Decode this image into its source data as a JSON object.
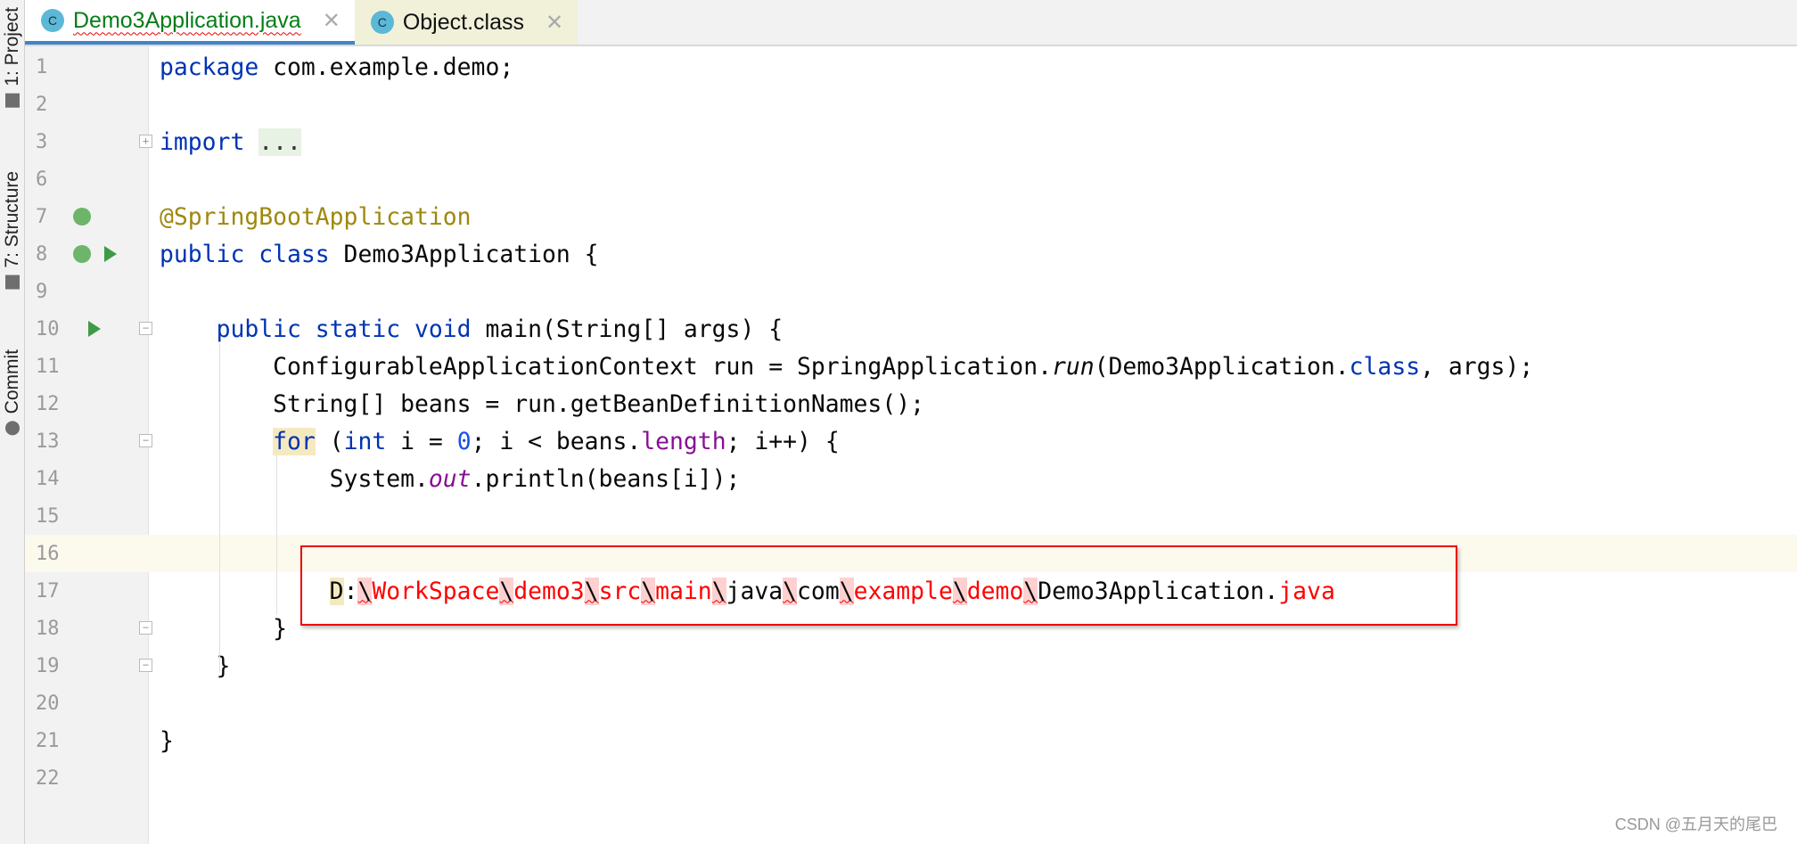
{
  "sidebar": {
    "items": [
      {
        "label": "1: Project",
        "icon": "folder-icon"
      },
      {
        "label": "7: Structure",
        "icon": "structure-icon"
      },
      {
        "label": "Commit",
        "icon": "commit-icon"
      }
    ]
  },
  "tabs": [
    {
      "label": "Demo3Application.java",
      "active": true,
      "icon": "java-class-icon"
    },
    {
      "label": "Object.class",
      "active": false,
      "icon": "class-file-icon"
    }
  ],
  "editor": {
    "current_line": 16,
    "lines": [
      {
        "n": "1",
        "t": [
          [
            "package",
            "kw"
          ],
          [
            " com.example.demo;",
            ""
          ]
        ]
      },
      {
        "n": "2",
        "t": []
      },
      {
        "n": "3",
        "t": [
          [
            "import",
            "kw"
          ],
          [
            " ",
            ""
          ],
          [
            "...",
            "fold"
          ]
        ]
      },
      {
        "n": "6",
        "t": []
      },
      {
        "n": "7",
        "t": [
          [
            "@SpringBootApplication",
            "ann"
          ]
        ]
      },
      {
        "n": "8",
        "t": [
          [
            "public class",
            "kw"
          ],
          [
            " Demo3Application {",
            ""
          ]
        ]
      },
      {
        "n": "9",
        "t": []
      },
      {
        "n": "10",
        "t": [
          [
            "    ",
            ""
          ],
          [
            "public static void",
            "kw"
          ],
          [
            " main(String[] args) {",
            ""
          ]
        ]
      },
      {
        "n": "11",
        "t": [
          [
            "        ConfigurableApplicationContext run = SpringApplication.",
            ""
          ],
          [
            "run",
            "it"
          ],
          [
            "(Demo3Application.",
            ""
          ],
          [
            "class",
            "kw"
          ],
          [
            ", args);",
            ""
          ]
        ]
      },
      {
        "n": "12",
        "t": [
          [
            "        String[] beans = run.getBeanDefinitionNames();",
            ""
          ]
        ]
      },
      {
        "n": "13",
        "t": [
          [
            "        ",
            ""
          ],
          [
            "for",
            "kw hl"
          ],
          [
            " (",
            ""
          ],
          [
            "int",
            "kw"
          ],
          [
            " i = ",
            ""
          ],
          [
            "0",
            "num"
          ],
          [
            "; i < beans.",
            ""
          ],
          [
            "length",
            "fld"
          ],
          [
            "; i++) {",
            ""
          ]
        ]
      },
      {
        "n": "14",
        "t": [
          [
            "            System.",
            ""
          ],
          [
            "out",
            "fld it"
          ],
          [
            ".println(beans[i]);",
            ""
          ]
        ]
      },
      {
        "n": "15",
        "t": []
      },
      {
        "n": "16",
        "t": []
      },
      {
        "n": "17",
        "t": [
          [
            "            ",
            ""
          ],
          [
            "D",
            "hl"
          ],
          [
            ":",
            ""
          ],
          [
            "\\",
            "bs"
          ],
          [
            "WorkSpace",
            "red"
          ],
          [
            "\\",
            "bs"
          ],
          [
            "demo3",
            "red"
          ],
          [
            "\\",
            "bs"
          ],
          [
            "src",
            "red"
          ],
          [
            "\\",
            "bs"
          ],
          [
            "main",
            "red"
          ],
          [
            "\\",
            "bs"
          ],
          [
            "java",
            ""
          ],
          [
            "\\",
            "bs"
          ],
          [
            "com",
            ""
          ],
          [
            "\\",
            "bs"
          ],
          [
            "example",
            "red"
          ],
          [
            "\\",
            "bs"
          ],
          [
            "demo",
            "red"
          ],
          [
            "\\",
            "bs"
          ],
          [
            "Demo3Application.",
            ""
          ],
          [
            "java",
            "red"
          ]
        ]
      },
      {
        "n": "18",
        "t": [
          [
            "        }",
            ""
          ]
        ]
      },
      {
        "n": "19",
        "t": [
          [
            "    }",
            ""
          ]
        ]
      },
      {
        "n": "20",
        "t": []
      },
      {
        "n": "21",
        "t": [
          [
            "}",
            ""
          ]
        ]
      },
      {
        "n": "22",
        "t": []
      }
    ]
  },
  "watermark": "CSDN @五月天的尾巴"
}
